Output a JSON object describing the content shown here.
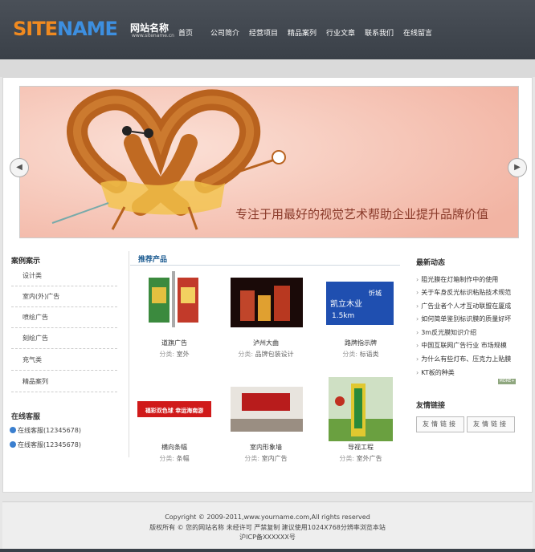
{
  "header": {
    "logo_part1": "SITE",
    "logo_part2": "NAME",
    "logo_cn": "网站名称",
    "logo_url": "www.sitename.cn",
    "nav": [
      "首页",
      "公司简介",
      "经营项目",
      "精品案列",
      "行业文章",
      "联系我们",
      "在线留言"
    ]
  },
  "banner": {
    "slogan": "专注于用最好的视觉艺术帮助企业提升品牌价值",
    "prev_icon": "chevron-left-icon",
    "next_icon": "chevron-right-icon"
  },
  "sidebar": {
    "cases_title": "案例案示",
    "cases": [
      "设计类",
      "室内(外)广告",
      "喷绘广告",
      "刻绘广告",
      "充气类",
      "精品案列"
    ],
    "service_title": "在线客服",
    "service": [
      "在线客服(12345678)",
      "在线客服(12345678)"
    ]
  },
  "products": {
    "title": "推荐产品",
    "cat_label": "分类:",
    "items": [
      {
        "name": "道旗广告",
        "category": "室外"
      },
      {
        "name": "泸州大曲",
        "category": "品牌包装设计"
      },
      {
        "name": "路牌指示牌",
        "category": "标语类"
      },
      {
        "name": "横向条幅",
        "category": "条幅"
      },
      {
        "name": "室内形象墙",
        "category": "室内广告"
      },
      {
        "name": "导视工程",
        "category": "室外广告"
      }
    ],
    "sign_text_1": "凯立木业",
    "sign_text_2": "1.5km",
    "sign_text_3": "忻城",
    "banner_text": "福彩双色球 幸运海南游"
  },
  "news": {
    "title": "最新动态",
    "items": [
      "阻光膜在灯箱制作中的使用",
      "关于车身反光标识粘贴技术规范",
      "广告业者个人才互动联盟在厦成",
      "如何简单鉴别标识膜的质量好坏",
      "3m反光膜知识介绍",
      "中国互联网广告行业 市场规模",
      "为什么有些灯布、压克力上贴膜",
      "KT板的种类"
    ],
    "more": "MORE+"
  },
  "links": {
    "title": "友情链接",
    "buttons": [
      "友情链接",
      "友情链接"
    ]
  },
  "footer": {
    "line1": "Copyright © 2009-2011,www.yourname.com,All rights reserved",
    "line2": "版权所有 © 您的网站名称  未经许可  严禁复制  建议使用1024X768分辨率浏览本站",
    "line3": "沪ICP备XXXXXX号"
  }
}
